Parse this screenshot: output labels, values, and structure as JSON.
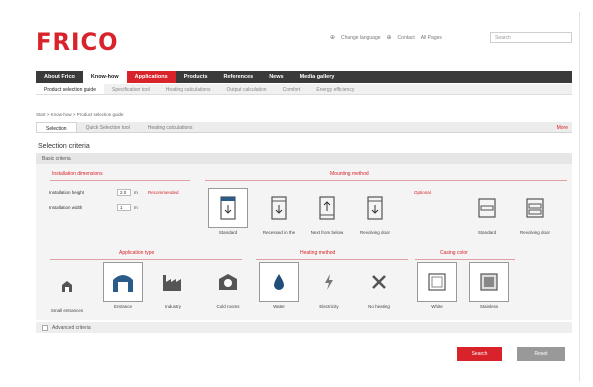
{
  "brand": {
    "logo_text": "FRICO",
    "accent": "#d8232a",
    "nav_bg": "#3a3a3a"
  },
  "toplinks": {
    "change_language": "Change language",
    "contact": "Contact",
    "all_pages": "All Pages",
    "search_placeholder": "Search"
  },
  "mainnav": [
    {
      "label": "About Frico"
    },
    {
      "label": "Know-how"
    },
    {
      "label": "Applications"
    },
    {
      "label": "Products"
    },
    {
      "label": "References"
    },
    {
      "label": "News"
    },
    {
      "label": "Media gallery"
    }
  ],
  "subnav": [
    {
      "label": "Product selection guide"
    },
    {
      "label": "Specification tool"
    },
    {
      "label": "Heating calculations"
    },
    {
      "label": "Output calculation"
    },
    {
      "label": "Comfort"
    },
    {
      "label": "Energy efficiency"
    }
  ],
  "breadcrumb": "Start > Know-how > Product selection guide",
  "tabs": {
    "items": [
      {
        "label": "Selection"
      },
      {
        "label": "Quick Selection tool"
      },
      {
        "label": "Heating calculations"
      }
    ],
    "right_link": "More"
  },
  "selection": {
    "title": "Selection criteria",
    "basic_header": "Basic criteria",
    "installation_dimensions": "Installation dimensions",
    "mounting_method": "Mounting method",
    "height_label": "Installation height",
    "height_value": "2.0",
    "width_label": "Installation width",
    "width_value": "1",
    "unit": "m",
    "recommended": "Recommended",
    "optional": "Optional",
    "mounting_cards": [
      {
        "label": "Standard",
        "icon": "standard-mount-icon"
      },
      {
        "label": "Recessed in the",
        "icon": "recessed-icon"
      },
      {
        "label": "Next from below",
        "icon": "below-icon"
      },
      {
        "label": "Revolving door",
        "icon": "revolving-door-icon"
      }
    ],
    "optional_cards": [
      {
        "label": "Standard",
        "icon": "standard-icon"
      },
      {
        "label": "Revolving door",
        "icon": "revolving-icon"
      }
    ],
    "application_type": "Application type",
    "heating_method": "Heating method",
    "casing_color": "Casing color",
    "application_cards": [
      {
        "label": "Small entrances",
        "icon": "small-entrance-icon"
      },
      {
        "label": "Entrance",
        "icon": "entrance-icon"
      },
      {
        "label": "Industry",
        "icon": "industry-icon"
      },
      {
        "label": "Cold rooms",
        "icon": "cold-room-icon"
      }
    ],
    "heating_cards": [
      {
        "label": "Water",
        "icon": "water-drop-icon"
      },
      {
        "label": "Electricity",
        "icon": "lightning-icon"
      },
      {
        "label": "No heating",
        "icon": "fan-icon"
      }
    ],
    "color_cards": [
      {
        "label": "White",
        "icon": "white-casing-icon"
      },
      {
        "label": "Stainless",
        "icon": "stainless-casing-icon"
      }
    ],
    "advanced": "Advanced criteria"
  },
  "buttons": {
    "search": "Search",
    "reset": "Reset"
  }
}
